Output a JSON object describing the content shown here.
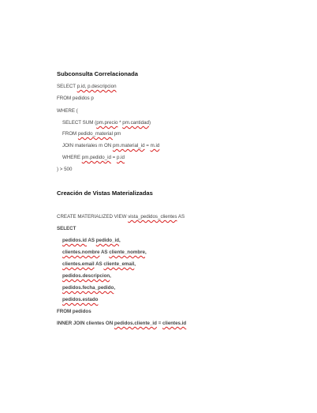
{
  "sections": [
    {
      "title": "Subconsulta Correlacionada",
      "lines": [
        [
          "SELECT ",
          "p.id, p.descripcion"
        ],
        [
          "FROM pedidos p"
        ],
        [
          "WHERE ("
        ],
        [
          "SELECT SUM (",
          "pm.precio",
          " * ",
          "pm.cantidad",
          ")"
        ],
        [
          "FROM ",
          "pedido_material",
          " pm"
        ],
        [
          "JOIN materiales m ON ",
          "pm.material_id",
          " = ",
          "m.id"
        ],
        [
          "WHERE ",
          "pm.pedido_id",
          " = ",
          "p.id"
        ],
        [
          ") > 500"
        ]
      ]
    },
    {
      "title": "Creación de Vistas Materializadas",
      "lines": [
        [
          "CREATE MATERIALIZED VIEW ",
          "vista_pedidos_clientes",
          " AS"
        ],
        [
          "SELECT"
        ],
        [
          "pedidos.id",
          " AS ",
          "pedido_id",
          ","
        ],
        [
          "clientes.nombre",
          " AS ",
          "cliente_nombre",
          ","
        ],
        [
          "clientes.email",
          " AS ",
          "cliente_email",
          ","
        ],
        [
          "pedidos.descripcion",
          ","
        ],
        [
          "pedidos.fecha_pedido",
          ","
        ],
        [
          "pedidos.estado"
        ],
        [
          "FROM pedidos"
        ],
        [
          "INNER JOIN clientes ON ",
          "pedidos.cliente_id",
          " = ",
          "clientes.id"
        ]
      ]
    }
  ],
  "colors": {
    "spellcheck_underline": "#d81e1e",
    "text": "#444444",
    "heading": "#111111"
  }
}
